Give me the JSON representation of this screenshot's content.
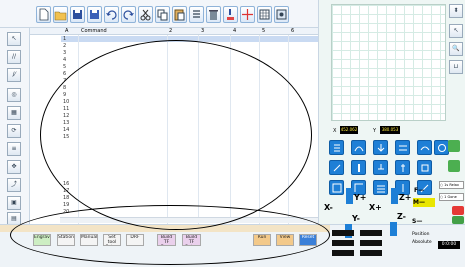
{
  "table": {
    "headers": [
      "A",
      "Command",
      "2",
      "3",
      "4",
      "5",
      "6"
    ],
    "rows": [
      "1",
      "2",
      "3",
      "4",
      "5",
      "6",
      "7",
      "8",
      "9",
      "10",
      "11",
      "12",
      "13",
      "14",
      "15",
      "16",
      "17",
      "18",
      "19",
      "20"
    ]
  },
  "coords": {
    "x_label": "X",
    "x_value": "452.062",
    "y_label": "Y",
    "y_value": "380.053"
  },
  "bottom_buttons": [
    "Engrave",
    "Station",
    "Manual",
    "Set tool Setup",
    "DRF",
    "Build TF From",
    "Build TF Setup",
    "Run",
    "View",
    "Reset"
  ],
  "axis": {
    "xminus": "X-",
    "xplus": "X+",
    "yplus": "Y+",
    "yminus": "Y-",
    "zplus": "Z+",
    "zminus": "Z-",
    "f": "F—",
    "m": "M—",
    "s": "S—"
  },
  "right_labels": {
    "position": "Position",
    "absolute": "Absolute",
    "time": "0:0:00"
  },
  "right_options": [
    "1s Relax",
    "1 Gone"
  ],
  "colors": {
    "accent": "#1e7fd6",
    "selected_row": "#c9daf2",
    "run": "#f3c98a",
    "view": "#f3c98a",
    "reset": "#3a7fd8"
  }
}
